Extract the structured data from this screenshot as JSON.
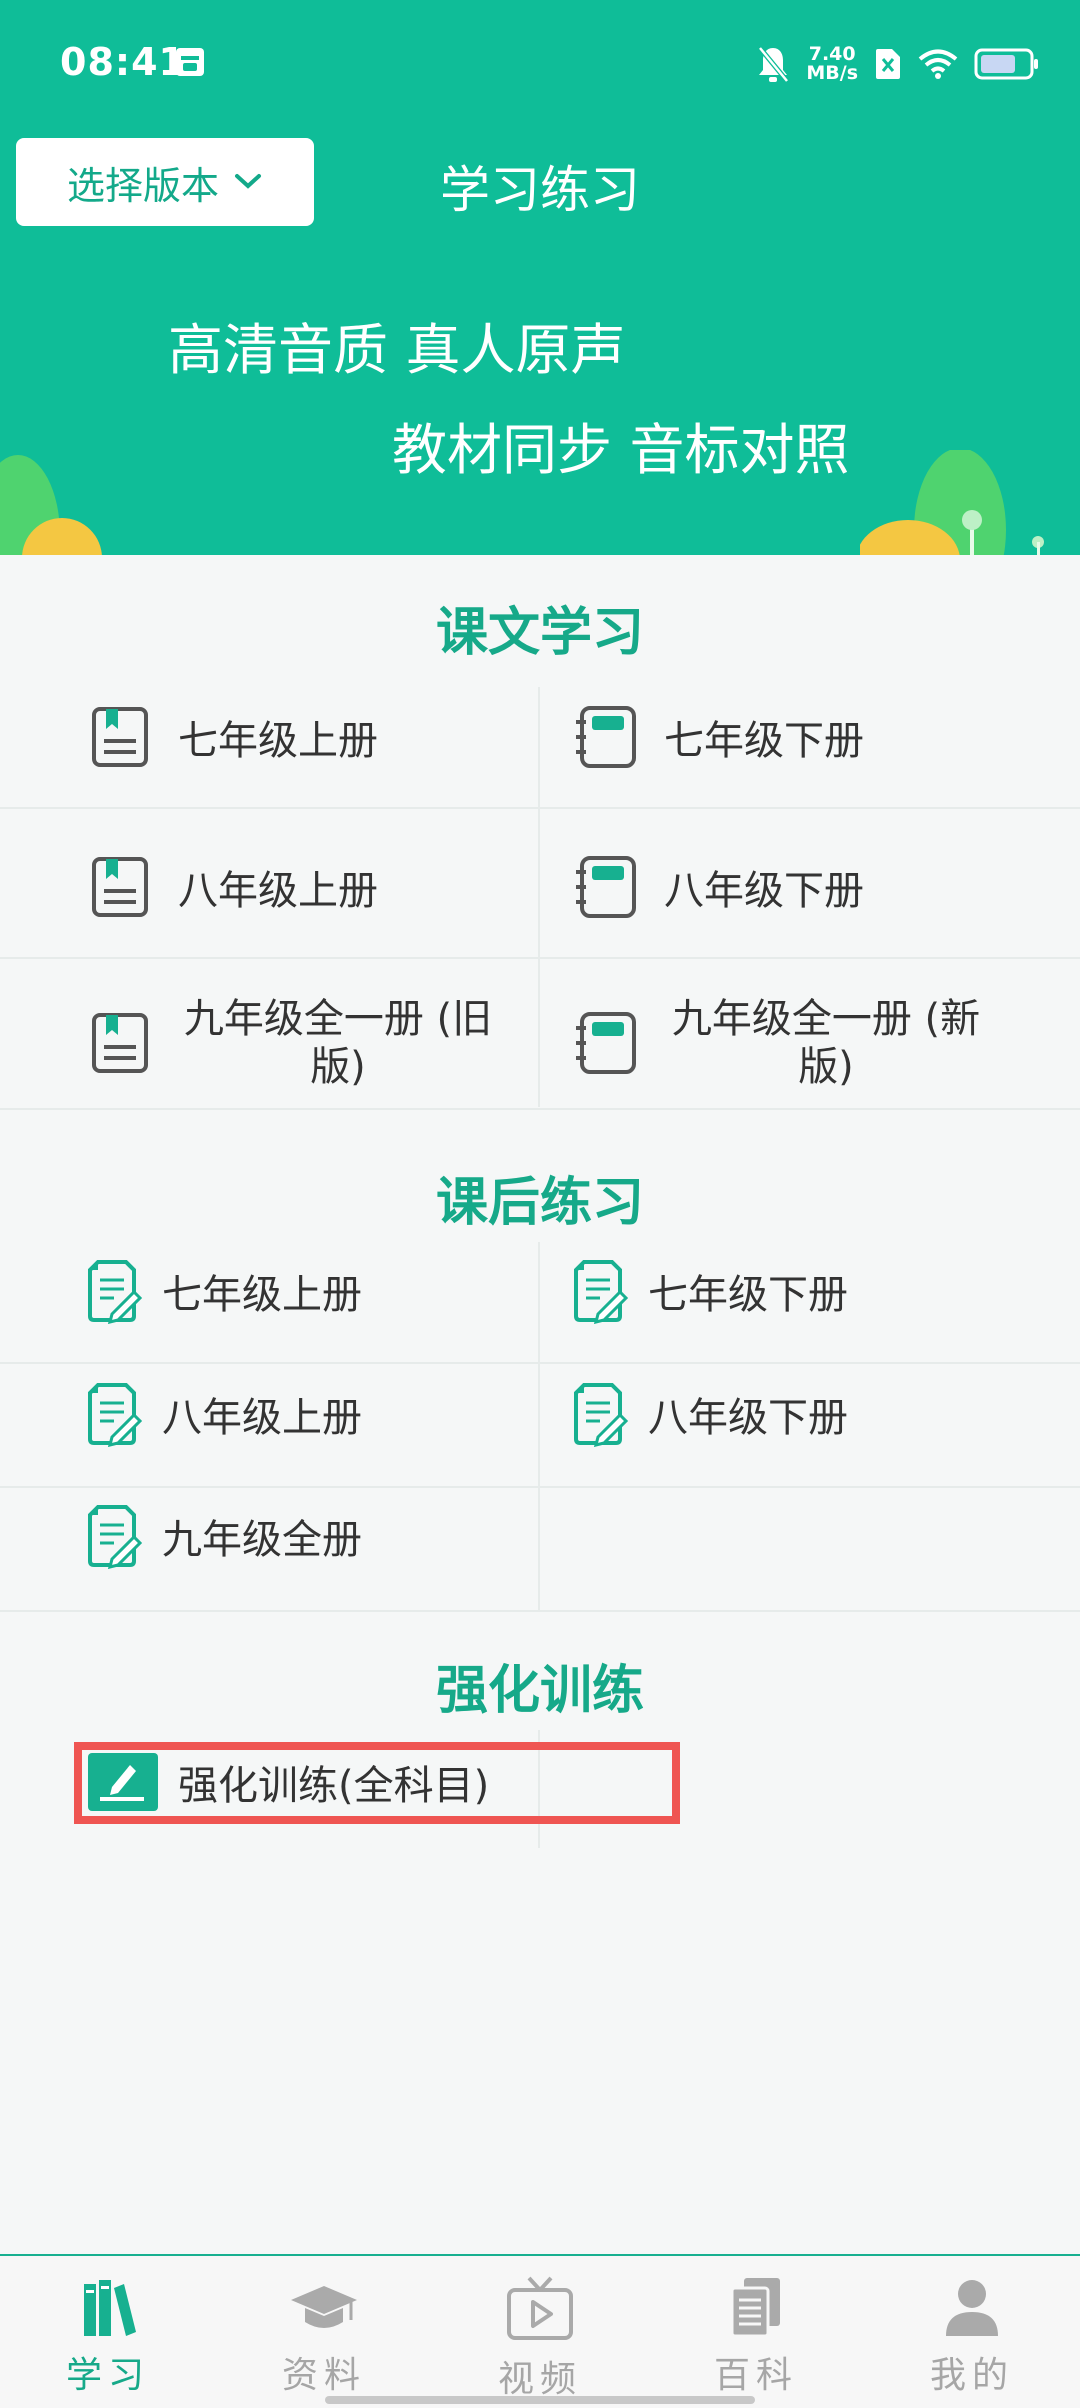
{
  "status_bar": {
    "time": "08:41",
    "net_speed_value": "7.40",
    "net_speed_unit": "MB/s",
    "icons": [
      "calendar-icon",
      "bell-off-icon",
      "no-sim-icon",
      "wifi-icon",
      "battery-icon"
    ]
  },
  "header": {
    "version_button_label": "选择版本",
    "title": "学习练习",
    "slogan_line1": "高清音质 真人原声",
    "slogan_line2": "教材同步 音标对照",
    "bg_color": "#0fbd98"
  },
  "sections": {
    "textbook": {
      "title": "课文学习",
      "items": [
        "七年级上册",
        "七年级下册",
        "八年级上册",
        "八年级下册",
        "九年级全一册 (旧版)",
        "九年级全一册 (新版)"
      ]
    },
    "exercise": {
      "title": "课后练习",
      "items": [
        "七年级上册",
        "七年级下册",
        "八年级上册",
        "八年级下册",
        "九年级全册"
      ]
    },
    "intensive": {
      "title": "强化训练",
      "items": [
        "强化训练(全科目)"
      ]
    }
  },
  "tabbar": {
    "tabs": [
      {
        "label": "学习",
        "icon": "books-icon",
        "active": true
      },
      {
        "label": "资料",
        "icon": "graduation-cap-icon",
        "active": false
      },
      {
        "label": "视频",
        "icon": "tv-play-icon",
        "active": false
      },
      {
        "label": "百科",
        "icon": "document-stack-icon",
        "active": false
      },
      {
        "label": "我的",
        "icon": "user-icon",
        "active": false
      }
    ]
  },
  "colors": {
    "accent": "#16a989",
    "highlight_border": "#ef5552"
  }
}
